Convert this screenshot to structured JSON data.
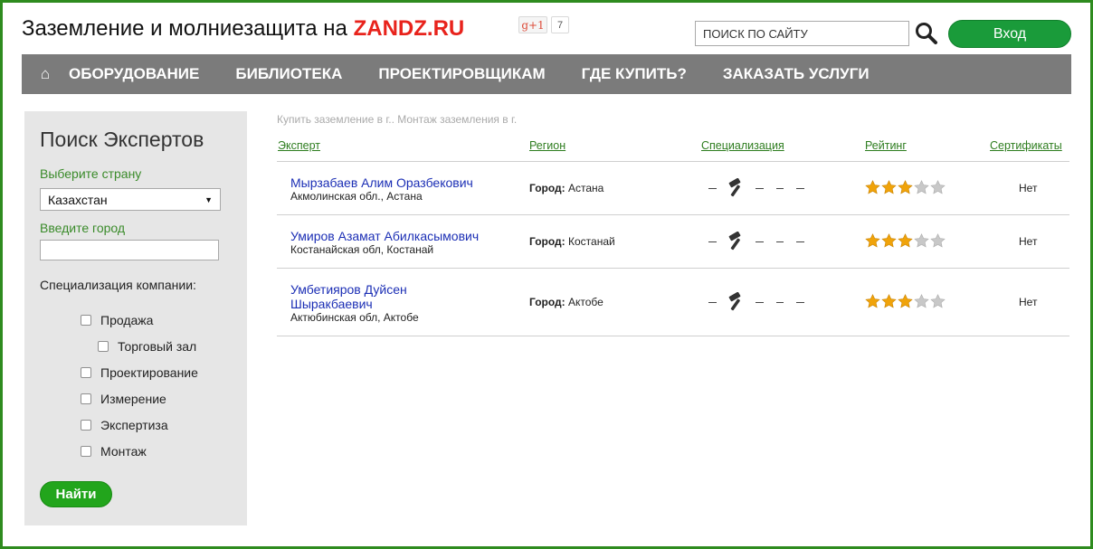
{
  "header": {
    "title_text": "Заземление и молниезащита на ",
    "title_brand": "ZANDZ.RU",
    "gplus_label": "g+1",
    "gplus_count": "7",
    "search_placeholder": "ПОИСК ПО САЙТУ",
    "login_label": "Вход"
  },
  "nav": {
    "home_icon": "⌂",
    "items": [
      "ОБОРУДОВАНИЕ",
      "БИБЛИОТЕКА",
      "ПРОЕКТИРОВЩИКАМ",
      "ГДЕ КУПИТЬ?",
      "ЗАКАЗАТЬ УСЛУГИ"
    ]
  },
  "sidebar": {
    "title": "Поиск Экспертов",
    "country_label": "Выберите страну",
    "country_value": "Казахстан",
    "city_label": "Введите город",
    "city_value": "",
    "spec_label": "Специализация компании:",
    "checkboxes": [
      "Продажа",
      "Торговый зал",
      "Проектирование",
      "Измерение",
      "Экспертиза",
      "Монтаж"
    ],
    "find_label": "Найти"
  },
  "main": {
    "breadcrumb": "Купить заземление в г.. Монтаж заземления в г.",
    "columns": [
      "Эксперт",
      "Регион",
      "Специализация",
      "Рейтинг",
      "Сертификаты"
    ],
    "rows": [
      {
        "name": "Мырзабаев Алим Оразбекович",
        "region": "Акмолинская обл., Астана",
        "city_label": "Город:",
        "city": "Астана",
        "rating": 3,
        "cert": "Нет"
      },
      {
        "name": "Умиров Азамат Абилкасымович",
        "region": "Костанайская обл, Костанай",
        "city_label": "Город:",
        "city": "Костанай",
        "rating": 3,
        "cert": "Нет"
      },
      {
        "name": "Умбетияров Дуйсен Шыракбаевич",
        "region": "Актюбинская обл, Актобе",
        "city_label": "Город:",
        "city": "Актобе",
        "rating": 3,
        "cert": "Нет"
      }
    ]
  },
  "colors": {
    "accent_green": "#1a9b3a",
    "link_blue": "#1c2fb5",
    "nav_gray": "#7b7b7b",
    "brand_red": "#e8231c",
    "star_gold": "#f0a30a"
  }
}
